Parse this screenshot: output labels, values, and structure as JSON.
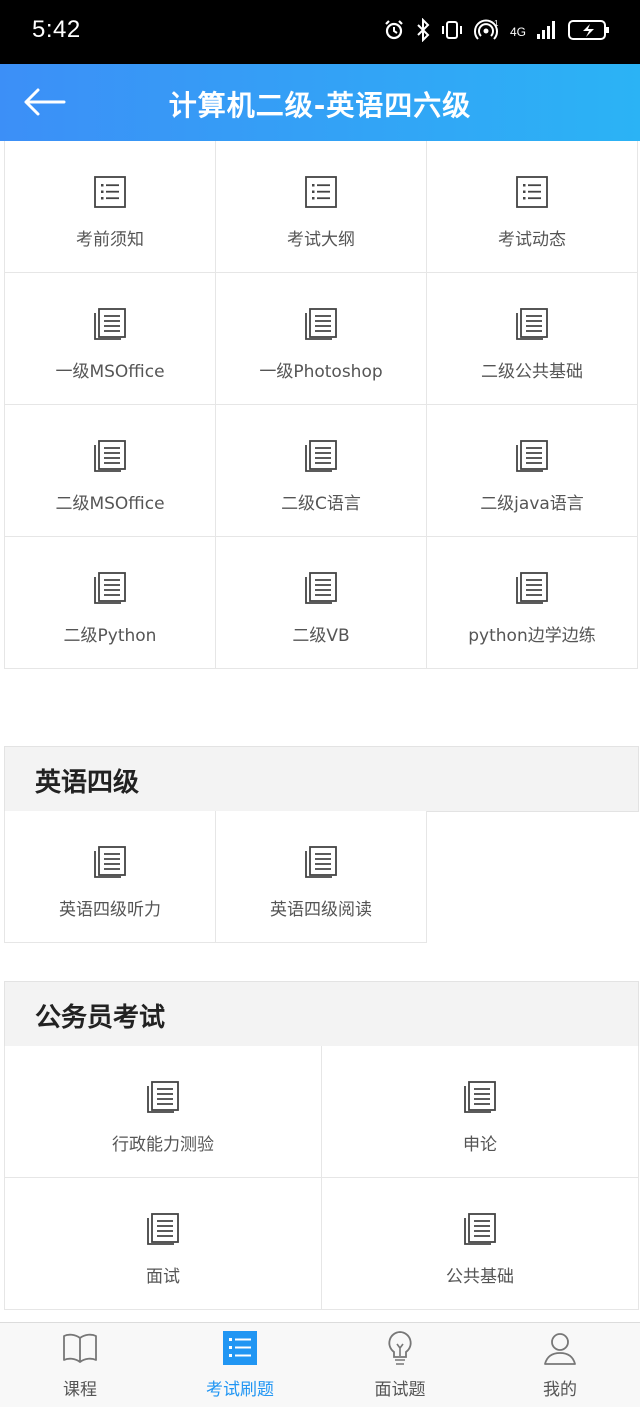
{
  "status_bar": {
    "time": "5:42",
    "network": "4G"
  },
  "header": {
    "title": "计算机二级-英语四六级",
    "back_icon": "arrow-left-icon"
  },
  "colors": {
    "accent": "#2196f3",
    "header_start": "#3c8ff7",
    "header_end": "#2bb3f5"
  },
  "computer_items": [
    {
      "label": "考前须知",
      "icon": "list-icon"
    },
    {
      "label": "考试大纲",
      "icon": "list-icon"
    },
    {
      "label": "考试动态",
      "icon": "list-icon"
    },
    {
      "label": "一级MSOffice",
      "icon": "document-icon"
    },
    {
      "label": "一级Photoshop",
      "icon": "document-icon"
    },
    {
      "label": "二级公共基础",
      "icon": "document-icon"
    },
    {
      "label": "二级MSOffice",
      "icon": "document-icon"
    },
    {
      "label": "二级C语言",
      "icon": "document-icon"
    },
    {
      "label": "二级java语言",
      "icon": "document-icon"
    },
    {
      "label": "二级Python",
      "icon": "document-icon"
    },
    {
      "label": "二级VB",
      "icon": "document-icon"
    },
    {
      "label": "python边学边练",
      "icon": "document-icon"
    }
  ],
  "cet4": {
    "title": "英语四级",
    "items": [
      {
        "label": "英语四级听力",
        "icon": "document-icon"
      },
      {
        "label": "英语四级阅读",
        "icon": "document-icon"
      }
    ]
  },
  "civil": {
    "title": "公务员考试",
    "items": [
      {
        "label": "行政能力测验",
        "icon": "document-icon"
      },
      {
        "label": "申论",
        "icon": "document-icon"
      },
      {
        "label": "面试",
        "icon": "document-icon"
      },
      {
        "label": "公共基础",
        "icon": "document-icon"
      }
    ]
  },
  "bottom_nav": [
    {
      "label": "课程",
      "icon": "book-icon"
    },
    {
      "label": "考试刷题",
      "icon": "list-icon",
      "active": true
    },
    {
      "label": "面试题",
      "icon": "lightbulb-icon"
    },
    {
      "label": "我的",
      "icon": "user-icon"
    }
  ]
}
